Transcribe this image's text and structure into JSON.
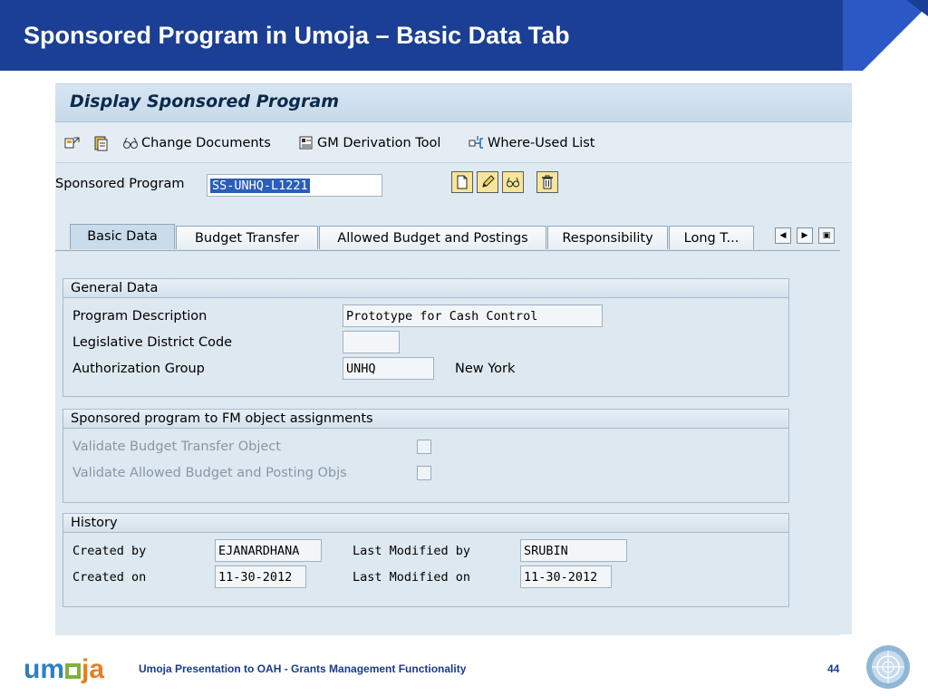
{
  "slide": {
    "title": "Sponsored Program in Umoja – Basic Data Tab",
    "footer_text": "Umoja Presentation to OAH - Grants Management Functionality",
    "page_number": "44",
    "logo": {
      "part1": "um",
      "part2": "ja"
    },
    "colors": {
      "banner": "#1a3f94",
      "accent": "#2b58c4"
    }
  },
  "sap": {
    "title": "Display Sponsored Program",
    "toolbar": {
      "change_documents": "Change Documents",
      "gm_derivation_tool": "GM Derivation Tool",
      "where_used_list": "Where-Used List"
    },
    "sponsored_program_label": "Sponsored Program",
    "sponsored_program_value": "SS-UNHQ-L1221",
    "tabs": [
      "Basic Data",
      "Budget Transfer",
      "Allowed Budget and Postings",
      "Responsibility",
      "Long T..."
    ],
    "general_data": {
      "heading": "General Data",
      "program_description_label": "Program Description",
      "program_description_value": "Prototype for Cash Control",
      "legislative_district_label": "Legislative District Code",
      "legislative_district_value": "",
      "authorization_group_label": "Authorization Group",
      "authorization_group_value": "UNHQ",
      "authorization_group_text": "New York"
    },
    "fm_assignments": {
      "heading": "Sponsored program to FM object assignments",
      "validate_budget_transfer": "Validate Budget Transfer Object",
      "validate_allowed_budget": "Validate Allowed Budget and Posting Objs"
    },
    "history": {
      "heading": "History",
      "created_by_label": "Created by",
      "created_by_value": "EJANARDHANA",
      "created_on_label": "Created on",
      "created_on_value": "11-30-2012",
      "last_modified_by_label": "Last Modified by",
      "last_modified_by_value": "SRUBIN",
      "last_modified_on_label": "Last Modified on",
      "last_modified_on_value": "11-30-2012"
    }
  }
}
